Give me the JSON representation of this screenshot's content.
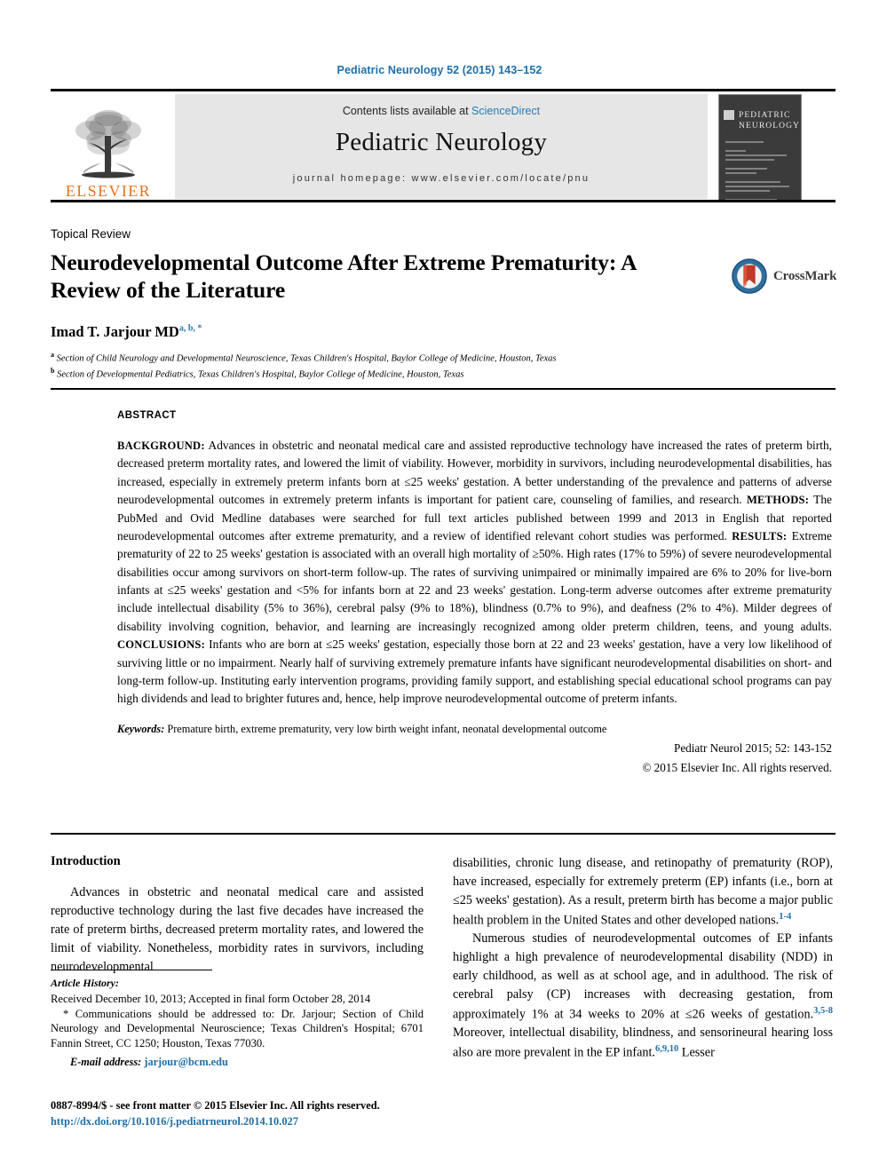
{
  "running_head": "Pediatric Neurology 52 (2015) 143–152",
  "masthead": {
    "contents_prefix": "Contents lists available at ",
    "sciencedirect": "ScienceDirect",
    "journal_title": "Pediatric Neurology",
    "homepage": "journal homepage: www.elsevier.com/locate/pnu",
    "publisher_wordmark": "ELSEVIER",
    "cover_title_line1": "PEDIATRIC",
    "cover_title_line2": "NEUROLOGY"
  },
  "article": {
    "section_label": "Topical Review",
    "title": "Neurodevelopmental Outcome After Extreme Prematurity: A Review of the Literature",
    "author": "Imad T. Jarjour MD",
    "author_marks": "a, b, *",
    "affiliation_a_mark": "a",
    "affiliation_a": "Section of Child Neurology and Developmental Neuroscience, Texas Children's Hospital, Baylor College of Medicine, Houston, Texas",
    "affiliation_b_mark": "b",
    "affiliation_b": "Section of Developmental Pediatrics, Texas Children's Hospital, Baylor College of Medicine, Houston, Texas",
    "crossmark_label": "CrossMark"
  },
  "abstract": {
    "heading": "ABSTRACT",
    "background_label": "BACKGROUND:",
    "background_text": " Advances in obstetric and neonatal medical care and assisted reproductive technology have increased the rates of preterm birth, decreased preterm mortality rates, and lowered the limit of viability. However, morbidity in survivors, including neurodevelopmental disabilities, has increased, especially in extremely preterm infants born at ≤25 weeks' gestation. A better understanding of the prevalence and patterns of adverse neurodevelopmental outcomes in extremely preterm infants is important for patient care, counseling of families, and research. ",
    "methods_label": "METHODS:",
    "methods_text": " The PubMed and Ovid Medline databases were searched for full text articles published between 1999 and 2013 in English that reported neurodevelopmental outcomes after extreme prematurity, and a review of identified relevant cohort studies was performed. ",
    "results_label": "RESULTS:",
    "results_text": " Extreme prematurity of 22 to 25 weeks' gestation is associated with an overall high mortality of ≥50%. High rates (17% to 59%) of severe neurodevelopmental disabilities occur among survivors on short-term follow-up. The rates of surviving unimpaired or minimally impaired are 6% to 20% for live-born infants at ≤25 weeks' gestation and <5% for infants born at 22 and 23 weeks' gestation. Long-term adverse outcomes after extreme prematurity include intellectual disability (5% to 36%), cerebral palsy (9% to 18%), blindness (0.7% to 9%), and deafness (2% to 4%). Milder degrees of disability involving cognition, behavior, and learning are increasingly recognized among older preterm children, teens, and young adults. ",
    "conclusions_label": "CONCLUSIONS:",
    "conclusions_text": " Infants who are born at ≤25 weeks' gestation, especially those born at 22 and 23 weeks' gestation, have a very low likelihood of surviving little or no impairment. Nearly half of surviving extremely premature infants have significant neurodevelopmental disabilities on short- and long-term follow-up. Instituting early intervention programs, providing family support, and establishing special educational school programs can pay high dividends and lead to brighter futures and, hence, help improve neurodevelopmental outcome of preterm infants.",
    "keywords_label": "Keywords:",
    "keywords_text": " Premature birth, extreme prematurity, very low birth weight infant, neonatal developmental outcome",
    "citation": "Pediatr Neurol 2015; 52: 143-152",
    "copyright": "© 2015 Elsevier Inc. All rights reserved."
  },
  "body": {
    "intro_heading": "Introduction",
    "left_p1": "Advances in obstetric and neonatal medical care and assisted reproductive technology during the last five decades have increased the rate of preterm births, decreased preterm mortality rates, and lowered the limit of viability. Nonetheless, morbidity rates in survivors, including neurodevelopmental",
    "right_p1_a": "disabilities, chronic lung disease, and retinopathy of prematurity (ROP), have increased, especially for extremely preterm (EP) infants (i.e., born at ≤25 weeks' gestation). As a result, preterm birth has become a major public health problem in the United States and other developed nations.",
    "right_p1_ref": "1-4",
    "right_p2_a": "Numerous studies of neurodevelopmental outcomes of EP infants highlight a high prevalence of neurodevelopmental disability (NDD) in early childhood, as well as at school age, and in adulthood. The risk of cerebral palsy (CP) increases with decreasing gestation, from approximately 1% at 34 weeks to 20% at ≤26 weeks of gestation.",
    "right_p2_ref1": "3,5-8",
    "right_p2_b": " Moreover, intellectual disability, blindness, and sensorineural hearing loss also are more prevalent in the EP infant.",
    "right_p2_ref2": "6,9,10",
    "right_p2_c": " Lesser"
  },
  "footnotes": {
    "history_title": "Article History:",
    "history_line": "Received December 10, 2013; Accepted in final form October 28, 2014",
    "correspondence": "* Communications should be addressed to: Dr. Jarjour; Section of Child Neurology and Developmental Neuroscience; Texas Children's Hospital; 6701 Fannin Street, CC 1250; Houston, Texas 77030.",
    "email_label": "E-mail address:",
    "email": "jarjour@bcm.edu",
    "issn_line": "0887-8994/$ - see front matter © 2015 Elsevier Inc. All rights reserved.",
    "doi": "http://dx.doi.org/10.1016/j.pediatrneurol.2014.10.027"
  }
}
